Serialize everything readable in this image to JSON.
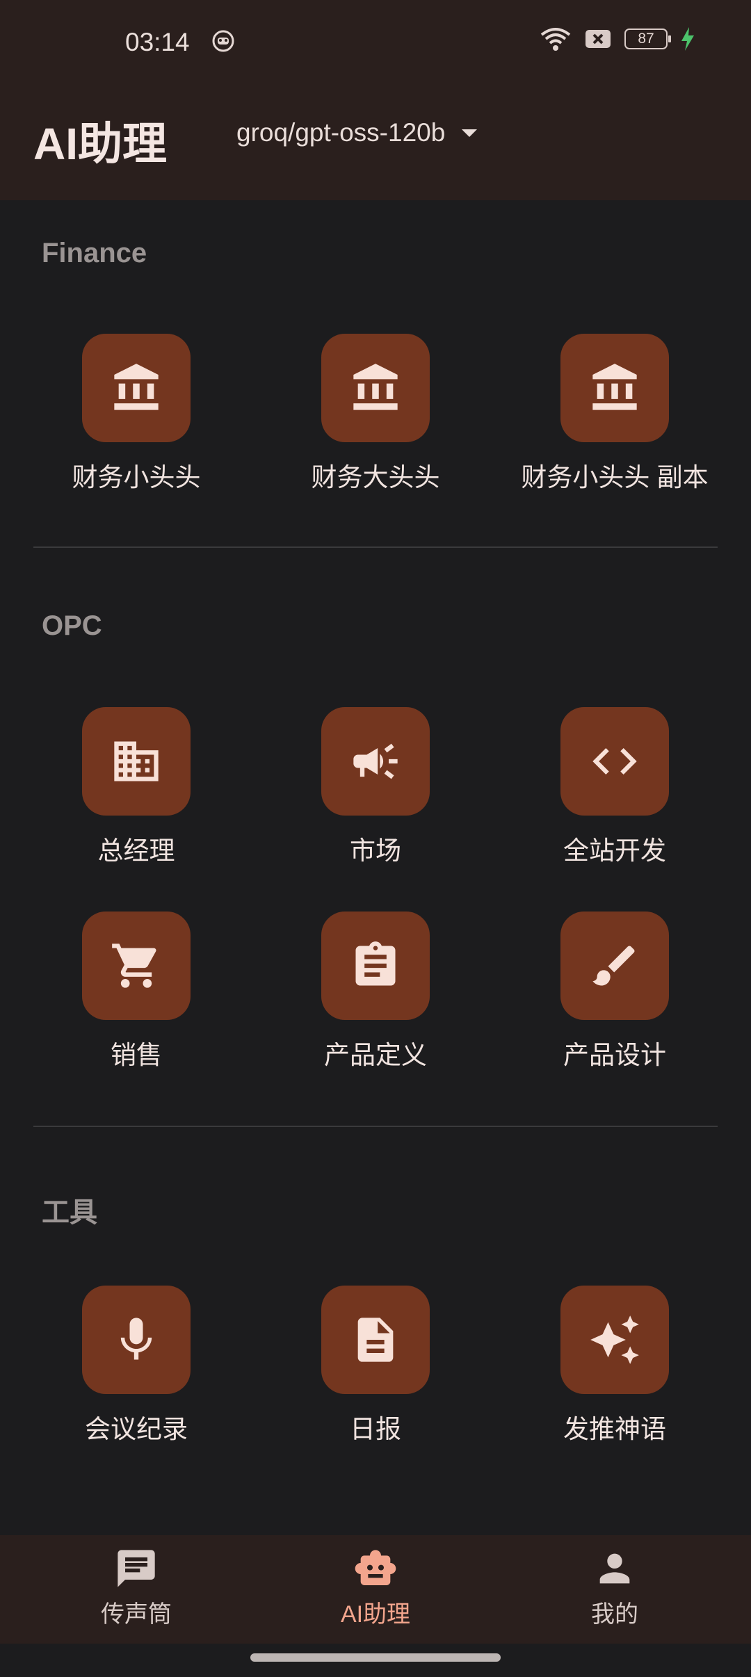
{
  "status_bar": {
    "time": "03:14",
    "battery": "87"
  },
  "app_bar": {
    "title": "AI助理",
    "model": "groq/gpt-oss-120b"
  },
  "sections": [
    {
      "title": "Finance",
      "items": [
        {
          "label": "财务小头头",
          "icon": "bank-icon"
        },
        {
          "label": "财务大头头",
          "icon": "bank-icon"
        },
        {
          "label": "财务小头头 副本",
          "icon": "bank-icon"
        }
      ]
    },
    {
      "title": "OPC",
      "items": [
        {
          "label": "总经理",
          "icon": "office-building-icon"
        },
        {
          "label": "市场",
          "icon": "megaphone-icon"
        },
        {
          "label": "全站开发",
          "icon": "code-icon"
        },
        {
          "label": "销售",
          "icon": "shopping-cart-icon"
        },
        {
          "label": "产品定义",
          "icon": "clipboard-icon"
        },
        {
          "label": "产品设计",
          "icon": "brush-icon"
        }
      ]
    },
    {
      "title": "工具",
      "items": [
        {
          "label": "会议纪录",
          "icon": "microphone-icon"
        },
        {
          "label": "日报",
          "icon": "document-icon"
        },
        {
          "label": "发推神语",
          "icon": "sparkles-icon"
        }
      ]
    }
  ],
  "bottom_nav": [
    {
      "label": "传声筒",
      "icon": "chat-icon",
      "active": false
    },
    {
      "label": "AI助理",
      "icon": "robot-icon",
      "active": true
    },
    {
      "label": "我的",
      "icon": "person-icon",
      "active": false
    }
  ],
  "colors": {
    "accent": "#f3a58d",
    "tile": "#74361f",
    "bar": "#2a1f1d",
    "background": "#1c1c1e"
  }
}
